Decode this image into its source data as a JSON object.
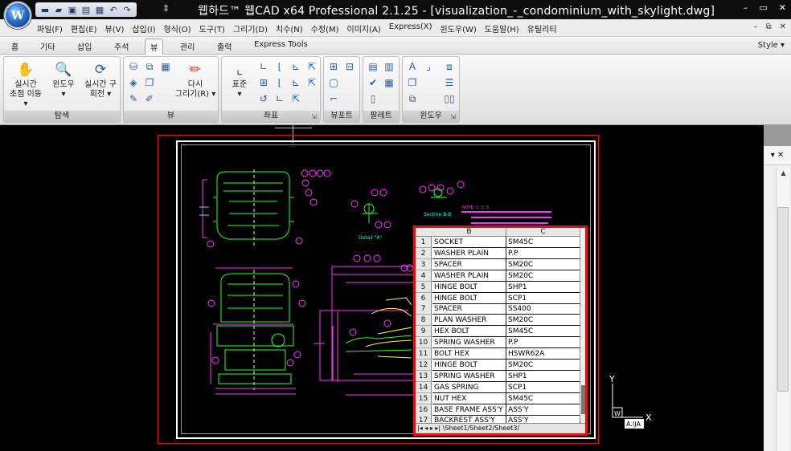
{
  "app": {
    "logo_letter": "W",
    "title": "웹하드™ 웹CAD  x64  Professional  2.1.25  -  [visualization_-_condominium_with_skylight.dwg]"
  },
  "quick_access": [
    {
      "name": "new-icon",
      "glyph": "▬"
    },
    {
      "name": "open-icon",
      "glyph": "▰"
    },
    {
      "name": "save-icon",
      "glyph": "▣"
    },
    {
      "name": "print-preview-icon",
      "glyph": "▤"
    },
    {
      "name": "print-icon",
      "glyph": "▦"
    },
    {
      "name": "undo-icon",
      "glyph": "↶"
    },
    {
      "name": "redo-icon",
      "glyph": "↷"
    }
  ],
  "qat_dropdown": "⇕",
  "window_controls": {
    "minimize": "–",
    "restore": "▭",
    "close": "✕"
  },
  "menu": [
    "파일(F)",
    "편집(E)",
    "뷰(V)",
    "삽입(I)",
    "형식(O)",
    "도구(T)",
    "그리기(D)",
    "치수(N)",
    "수정(M)",
    "이미지(A)",
    "Express(X)",
    "윈도우(W)",
    "도움말(H)",
    "유틸리티"
  ],
  "mdi_controls": {
    "minimize": "–",
    "restore": "⧉",
    "close": "✕"
  },
  "tabs": [
    {
      "label": "홈",
      "active": false
    },
    {
      "label": "기타",
      "active": false
    },
    {
      "label": "삽입",
      "active": false
    },
    {
      "label": "주석",
      "active": false
    },
    {
      "label": "뷰",
      "active": true
    },
    {
      "label": "관리",
      "active": false
    },
    {
      "label": "출력",
      "active": false
    },
    {
      "label": "Express Tools",
      "active": false
    }
  ],
  "style_label": "Style ▾",
  "ribbon": {
    "navigate": {
      "label": "탐색",
      "realtime_pan_line1": "실시간",
      "realtime_pan_line2": "초점 이동 ▾",
      "window_zoom_line1": "윈도우",
      "window_zoom_line2": "▾",
      "realtime_orbit_line1": "실시간 구",
      "realtime_orbit_line2": "회전 ▾"
    },
    "view": {
      "label": "뷰",
      "redraw_line1": "다시",
      "redraw_line2": "그리기(R) ▾"
    },
    "coords": {
      "label": "좌표",
      "standard_line1": "표준",
      "standard_line2": "▾"
    },
    "viewport": {
      "label": "뷰포트"
    },
    "palette": {
      "label": "팔레트"
    },
    "window": {
      "label": "윈도우"
    }
  },
  "spreadsheet": {
    "col_b": "B",
    "col_c": "C",
    "rows": [
      {
        "n": "1",
        "b": "SOCKET",
        "c": "SM45C"
      },
      {
        "n": "2",
        "b": "WASHER PLAIN",
        "c": "P.P"
      },
      {
        "n": "3",
        "b": "SPACER",
        "c": "SM20C"
      },
      {
        "n": "4",
        "b": "WASHER PLAIN",
        "c": "SM20C"
      },
      {
        "n": "5",
        "b": "HINGE BOLT",
        "c": "SHP1"
      },
      {
        "n": "6",
        "b": "HINGE BOLT",
        "c": "SCP1"
      },
      {
        "n": "7",
        "b": "SPACER",
        "c": "SS400"
      },
      {
        "n": "8",
        "b": "PLAN WASHER",
        "c": "SM20C"
      },
      {
        "n": "9",
        "b": "HEX BOLT",
        "c": "SM45C"
      },
      {
        "n": "10",
        "b": "SPRING WASHER",
        "c": "P.P"
      },
      {
        "n": "11",
        "b": "BOLT HEX",
        "c": "HSWR62A"
      },
      {
        "n": "12",
        "b": "HINGE BOLT",
        "c": "SM20C"
      },
      {
        "n": "13",
        "b": "SPRING WASHER",
        "c": "SHP1"
      },
      {
        "n": "14",
        "b": "GAS SPRING",
        "c": "SCP1"
      },
      {
        "n": "15",
        "b": "NUT HEX",
        "c": "SM45C"
      },
      {
        "n": "16",
        "b": "BASE FRAME ASS'Y",
        "c": "ASS'Y"
      },
      {
        "n": "17",
        "b": "BACKREST ASS'Y",
        "c": "ASS'Y"
      }
    ],
    "sheet_tabs": "|◂ ◂ ▸ ▸| \\Sheet1/Sheet2/Sheet3/"
  },
  "drawing": {
    "section_b": "Section B-B",
    "detail_a": "Detail \"A\"",
    "note_text": "NOTE: 1. 2. 3."
  },
  "ucs": {
    "y": "Y",
    "x": "X",
    "w": "W",
    "tag": "A.IJA"
  },
  "right_scroll": {
    "arrow": "▾ ✕",
    "up": "▲"
  }
}
